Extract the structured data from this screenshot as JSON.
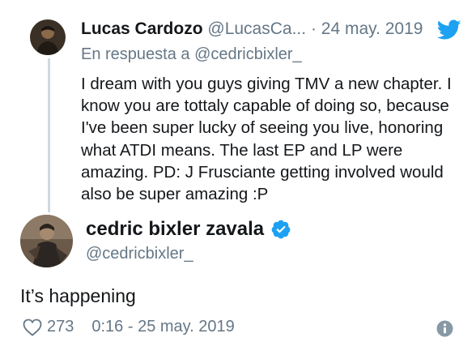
{
  "reply": {
    "name": "Lucas Cardozo",
    "handle": "@LucasCa...",
    "dot": "·",
    "date": "24 may. 2019",
    "in_reply_to_prefix": "En respuesta a",
    "in_reply_to_handle": "@cedricbixler_",
    "text": "I dream with you guys giving TMV a new chapter. I know you are tottaly capable of doing so, because I've been super lucky of seeing you live, honoring what ATDI means. The last EP and LP were amazing. PD: J Frusciante getting involved would also be super amazing :P"
  },
  "main": {
    "name": "cedric bixler zavala",
    "handle": "@cedricbixler_",
    "text": "It’s happening",
    "likes": "273",
    "timestamp": "0:16 - 25 may. 2019"
  },
  "icons": {
    "bird": "twitter-bird-icon",
    "verified": "verified-badge-icon",
    "heart": "heart-icon",
    "info": "info-icon"
  },
  "colors": {
    "twitter_blue": "#1da1f2",
    "muted": "#657786",
    "text": "#14171a",
    "thread_line": "#cfd9de"
  }
}
